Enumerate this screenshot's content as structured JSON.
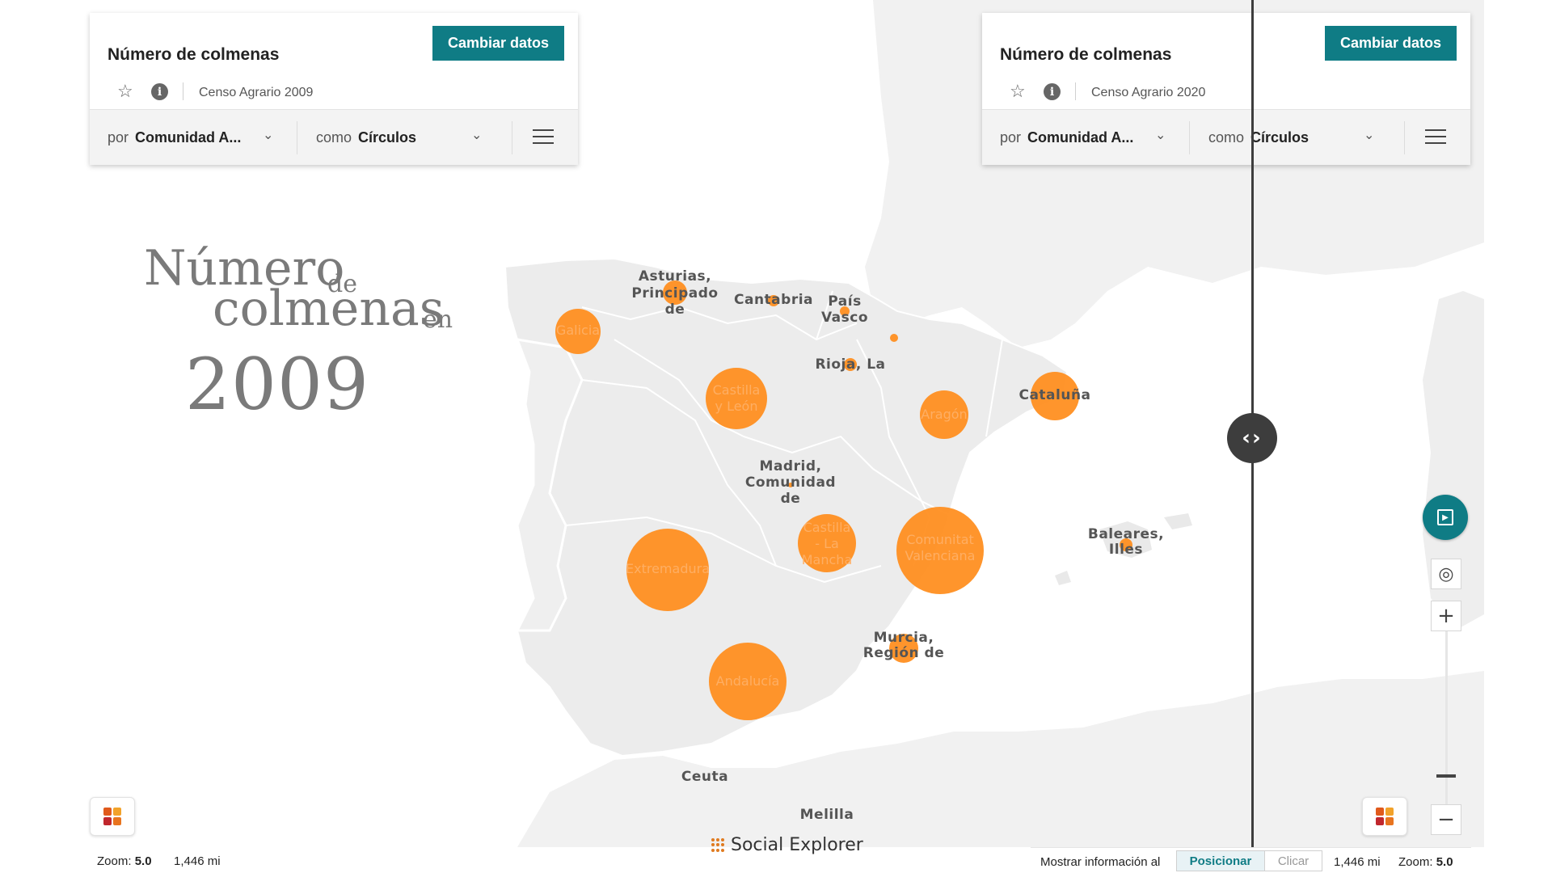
{
  "left_panel": {
    "title": "Número de colmenas",
    "change_label": "Cambiar datos",
    "source": "Censo Agrario 2009",
    "by_prefix": "por",
    "by_value": "Comunidad A...",
    "as_prefix": "como",
    "as_value": "Círculos"
  },
  "right_panel": {
    "title": "Número de colmenas",
    "change_label": "Cambiar datos",
    "source": "Censo Agrario 2020",
    "by_prefix": "por",
    "by_value": "Comunidad A...",
    "as_prefix": "como",
    "as_value": "Círculos"
  },
  "headline": {
    "line1": "Número",
    "line1_small": "de",
    "line2": "colmenas",
    "line2_small": "en",
    "year": "2009"
  },
  "map": {
    "region_labels": [
      "Asturias,",
      "Principado",
      "de",
      "Cantabria",
      "País",
      "Vasco",
      "Rioja, La",
      "Galicia",
      "Castilla",
      "y León",
      "Aragón",
      "Cataluña",
      "Madrid,",
      "Comunidad",
      "de",
      "Castilla",
      "- La",
      "Mancha",
      "Comunitat",
      "Valenciana",
      "Extremadura",
      "Andalucía",
      "Murcia,",
      "Región de",
      "Baleares,",
      "Illes",
      "Ceuta",
      "Melilla"
    ],
    "bubble_color": "#ff8c1a",
    "land_color": "#eeeeee"
  },
  "status": {
    "zoom_label": "Zoom:",
    "zoom_value": "5.0",
    "distance": "1,446 mi",
    "show_info_label": "Mostrar información al",
    "position_label": "Posicionar",
    "click_label": "Clicar",
    "right_distance": "1,446 mi",
    "right_zoom_label": "Zoom:",
    "right_zoom_value": "5.0"
  },
  "logo": {
    "text": "Social Explorer"
  },
  "colors": {
    "accent": "#0f7c85",
    "divider": "#3d3d3d"
  },
  "icons": [
    "star-icon",
    "info-icon",
    "chevron-down-icon",
    "menu-icon",
    "swipe-arrows-icon",
    "play-icon",
    "locate-icon",
    "zoom-in-icon",
    "zoom-out-icon",
    "palette-icon"
  ]
}
